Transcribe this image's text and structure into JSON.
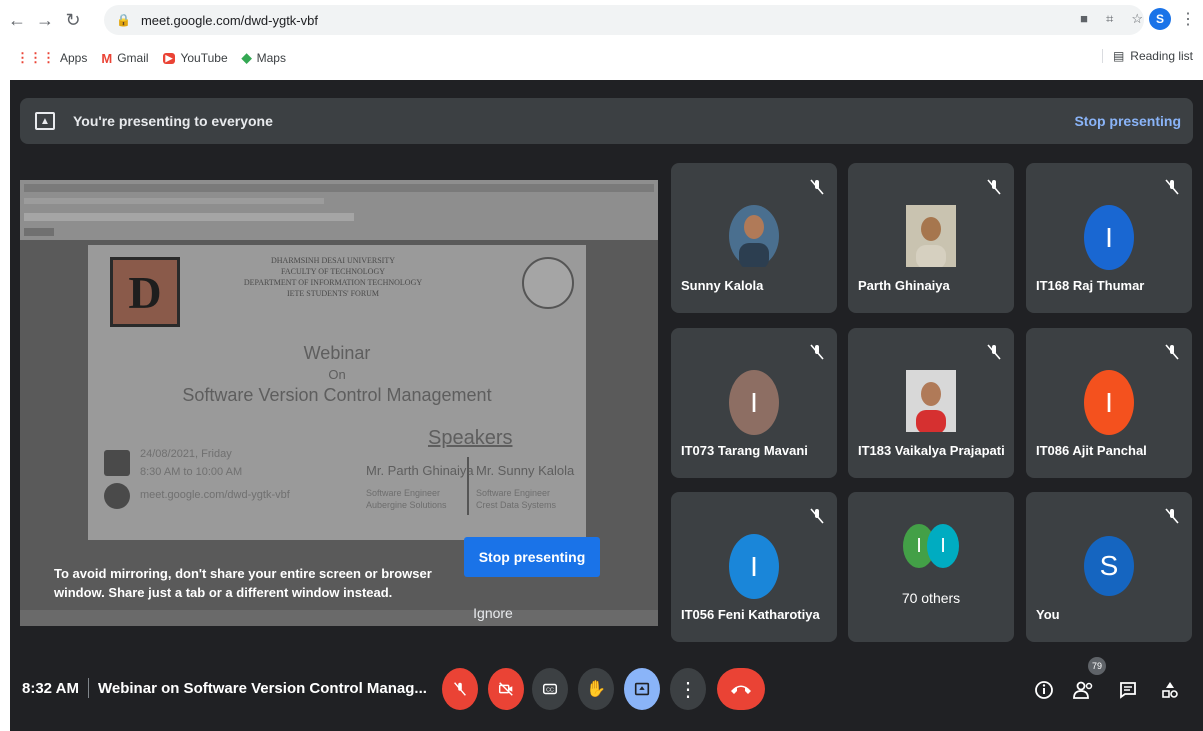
{
  "browser": {
    "url": "meet.google.com/dwd-ygtk-vbf",
    "profile_initial": "S",
    "bookmarks": [
      "Apps",
      "Gmail",
      "YouTube",
      "Maps"
    ],
    "reading_list": "Reading list"
  },
  "banner": {
    "message": "You're presenting to everyone",
    "stop_label": "Stop presenting"
  },
  "shared_screen": {
    "university_lines": [
      "DHARMSINH DESAI UNIVERSITY",
      "FACULTY OF TECHNOLOGY",
      "DEPARTMENT OF INFORMATION TECHNOLOGY",
      "IETE STUDENTS' FORUM"
    ],
    "webinar": "Webinar",
    "on": "On",
    "topic": "Software Version Control Management",
    "speakers_heading": "Speakers",
    "speaker1": "Mr. Parth Ghinaiya",
    "speaker1_role": "Software Engineer",
    "speaker1_org": "Aubergine Solutions",
    "speaker2": "Mr. Sunny Kalola",
    "speaker2_role": "Software Engineer",
    "speaker2_org": "Crest Data Systems",
    "date": "24/08/2021, Friday",
    "time": "8:30 AM to 10:00 AM",
    "link": "meet.google.com/dwd-ygtk-vbf"
  },
  "overlay": {
    "note": "To avoid mirroring, don't share your entire screen or browser window. Share just a tab or a different window instead.",
    "stop_button": "Stop presenting",
    "ignore_button": "Ignore"
  },
  "participants": [
    {
      "name": "Sunny Kalola",
      "type": "photo",
      "color": "#4a6f8f"
    },
    {
      "name": "Parth Ghinaiya",
      "type": "photo",
      "color": "#7a6a50"
    },
    {
      "name": "IT168 Raj Thumar",
      "type": "initial",
      "initial": "I",
      "color": "#1967d2"
    },
    {
      "name": "IT073 Tarang Mavani",
      "type": "initial",
      "initial": "I",
      "color": "#8d6e63"
    },
    {
      "name": "IT183 Vaikalya Prajapati",
      "type": "photo",
      "color": "#c0504d"
    },
    {
      "name": "IT086 Ajit Panchal",
      "type": "initial",
      "initial": "I",
      "color": "#f4511e"
    },
    {
      "name": "IT056 Feni Katharotiya",
      "type": "initial",
      "initial": "I",
      "color": "#1a86d9"
    },
    {
      "name": "70 others",
      "type": "group"
    },
    {
      "name": "You",
      "type": "initial",
      "initial": "S",
      "color": "#1565c0"
    }
  ],
  "others_initials": [
    "I",
    "I"
  ],
  "others_colors": [
    "#43a047",
    "#00acc1"
  ],
  "bottom_bar": {
    "time": "8:32 AM",
    "meeting_title": "Webinar on Software Version Control Manag...",
    "people_count": "79"
  }
}
